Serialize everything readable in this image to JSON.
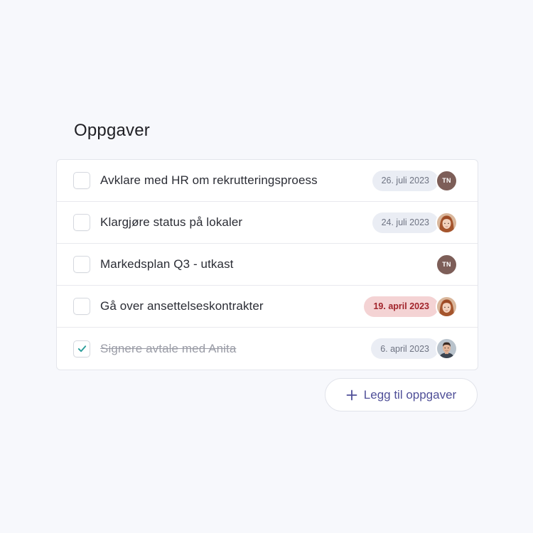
{
  "header": {
    "title": "Oppgaver"
  },
  "tasks": [
    {
      "title": "Avklare med HR om rekrutteringsproess",
      "date": "26. juli 2023",
      "date_status": "normal",
      "done": false,
      "assignee": {
        "type": "initials",
        "initials": "TN"
      }
    },
    {
      "title": "Klargjøre status på lokaler",
      "date": "24. juli 2023",
      "date_status": "normal",
      "done": false,
      "assignee": {
        "type": "photo",
        "icon": "woman-avatar-icon"
      }
    },
    {
      "title": "Markedsplan Q3 - utkast",
      "date": "",
      "date_status": "none",
      "done": false,
      "assignee": {
        "type": "initials",
        "initials": "TN"
      }
    },
    {
      "title": "Gå over ansettelseskontrakter",
      "date": "19. april 2023",
      "date_status": "overdue",
      "done": false,
      "assignee": {
        "type": "photo",
        "icon": "woman-avatar-icon"
      }
    },
    {
      "title": "Signere avtale med Anita",
      "date": "6. april 2023",
      "date_status": "normal",
      "done": true,
      "assignee": {
        "type": "photo",
        "icon": "man-avatar-icon"
      }
    }
  ],
  "actions": {
    "add_label": "Legg til oppgaver",
    "add_icon": "plus-icon"
  },
  "colors": {
    "accent": "#4f4f98",
    "check": "#2a9d9a",
    "overdue_bg": "#f4d3d4",
    "overdue_text": "#a1242b",
    "badge_bg": "#eaedf4",
    "initials_bg": "#7d5e58"
  }
}
